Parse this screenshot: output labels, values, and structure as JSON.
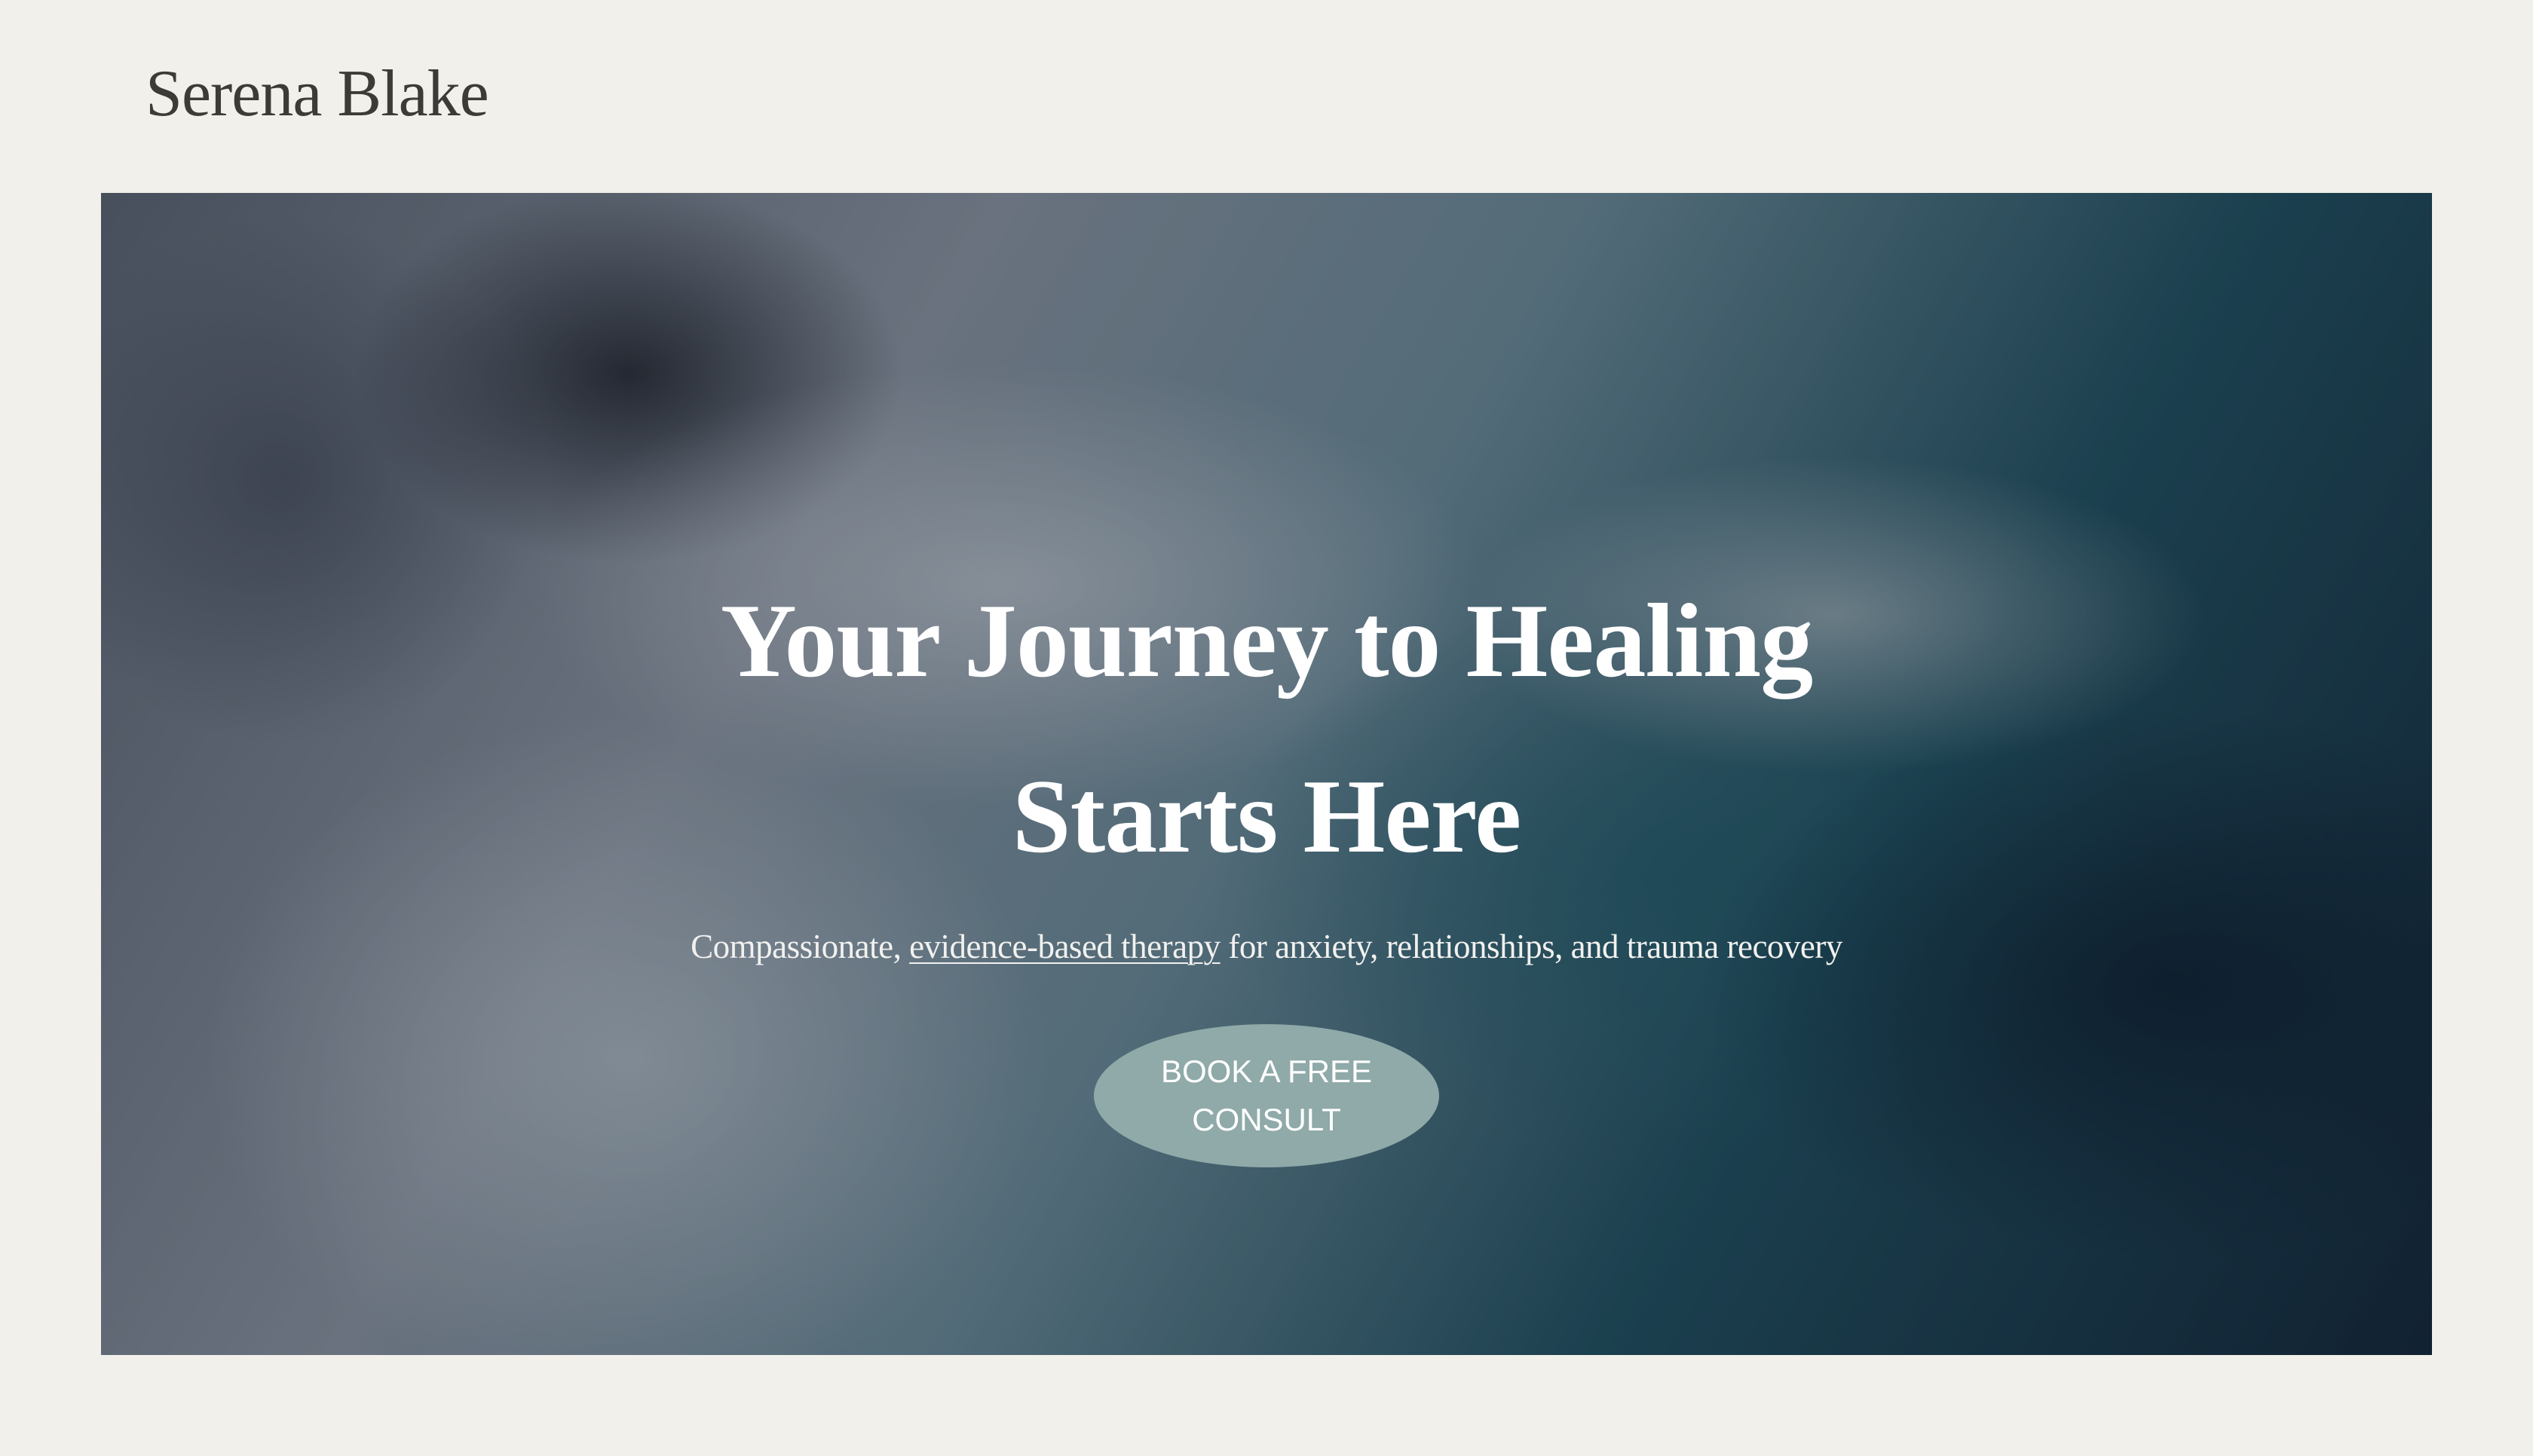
{
  "header": {
    "brand": "Serena Blake"
  },
  "hero": {
    "background_image": "ocean-waves-aerial",
    "headline_line1": "Your Journey to Healing",
    "headline_line2": "Starts Here",
    "tagline_before": "Compassionate, ",
    "tagline_link": "evidence-based therapy",
    "tagline_after": " for anxiety, relationships, and trauma recovery",
    "cta_label": "BOOK A FREE CONSULT"
  },
  "colors": {
    "page_background": "#f2f0ea",
    "brand_text": "#3d3b37",
    "cta_background": "#8faaa8",
    "hero_text": "#ffffff"
  }
}
